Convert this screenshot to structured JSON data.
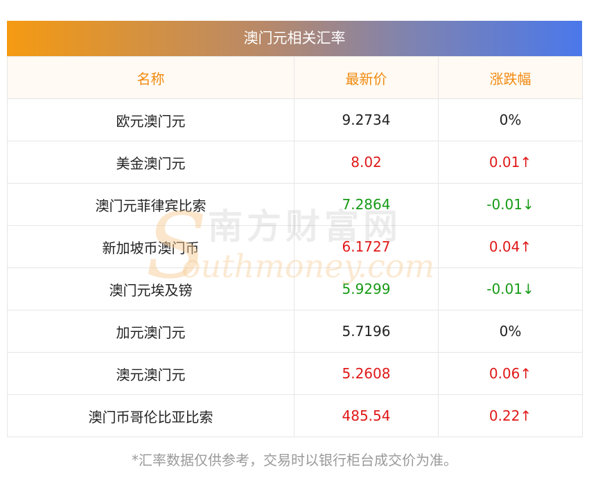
{
  "title": "澳门元相关汇率",
  "headers": [
    "名称",
    "最新价",
    "涨跌幅"
  ],
  "rows": [
    {
      "name": "欧元澳门元",
      "price": "9.2734",
      "change": "0%",
      "trend": "flat"
    },
    {
      "name": "美金澳门元",
      "price": "8.02",
      "change": "0.01↑",
      "trend": "up"
    },
    {
      "name": "澳门元菲律宾比索",
      "price": "7.2864",
      "change": "-0.01↓",
      "trend": "down"
    },
    {
      "name": "新加坡币澳门币",
      "price": "6.1727",
      "change": "0.04↑",
      "trend": "up"
    },
    {
      "name": "澳门元埃及镑",
      "price": "5.9299",
      "change": "-0.01↓",
      "trend": "down"
    },
    {
      "name": "加元澳门元",
      "price": "5.7196",
      "change": "0%",
      "trend": "flat"
    },
    {
      "name": "澳元澳门元",
      "price": "5.2608",
      "change": "0.06↑",
      "trend": "up"
    },
    {
      "name": "澳门币哥伦比亚比索",
      "price": "485.54",
      "change": "0.22↑",
      "trend": "up"
    }
  ],
  "footnote": "*汇率数据仅供参考，交易时以银行柜台成交价为准。",
  "watermark": {
    "cn": "南方财富网",
    "en": "outhmoney.com"
  },
  "colors": {
    "up": "#e01818",
    "down": "#169a16",
    "header_text": "#f18a10",
    "gradient_start": "#f59a12",
    "gradient_end": "#4a78ea"
  }
}
